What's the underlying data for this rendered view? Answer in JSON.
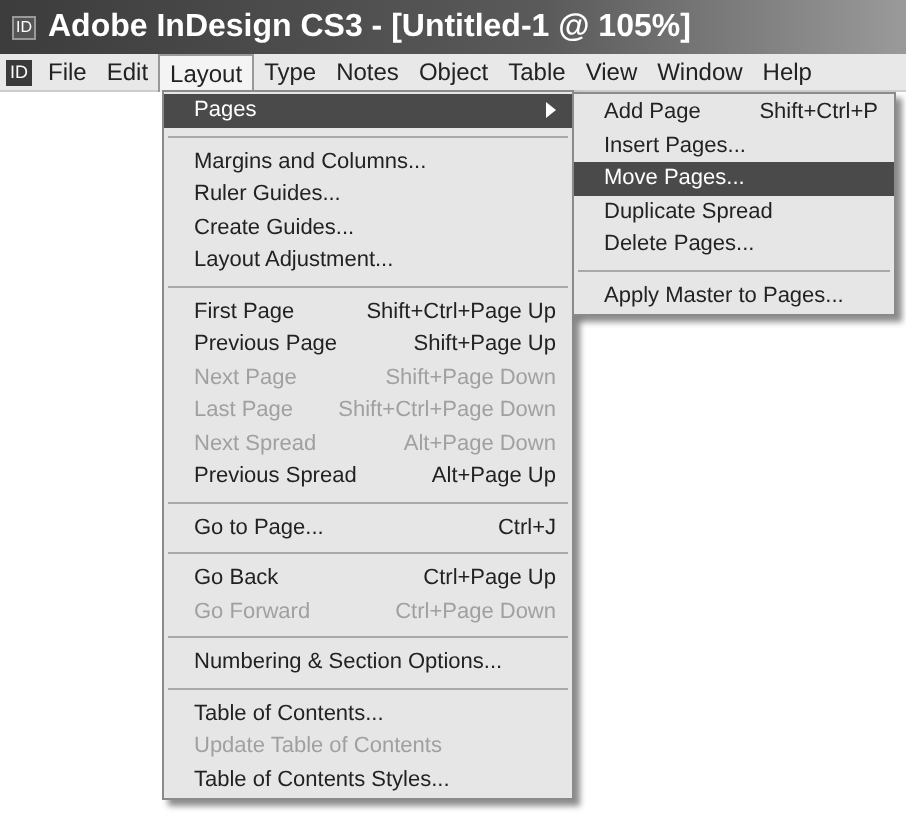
{
  "window": {
    "title": "Adobe InDesign CS3 - [Untitled-1 @ 105%]",
    "app_icon": "ID"
  },
  "menubar_icon": "ID",
  "menubar": [
    {
      "label": "File",
      "selected": false
    },
    {
      "label": "Edit",
      "selected": false
    },
    {
      "label": "Layout",
      "selected": true
    },
    {
      "label": "Type",
      "selected": false
    },
    {
      "label": "Notes",
      "selected": false
    },
    {
      "label": "Object",
      "selected": false
    },
    {
      "label": "Table",
      "selected": false
    },
    {
      "label": "View",
      "selected": false
    },
    {
      "label": "Window",
      "selected": false
    },
    {
      "label": "Help",
      "selected": false
    }
  ],
  "layout_menu": {
    "sections": [
      [
        {
          "label": "Pages",
          "selected": true,
          "disabled": false,
          "submenu": true
        }
      ],
      [
        {
          "label": "Margins and Columns...",
          "selected": false,
          "disabled": false
        },
        {
          "label": "Ruler Guides...",
          "selected": false,
          "disabled": false
        },
        {
          "label": "Create Guides...",
          "selected": false,
          "disabled": false
        },
        {
          "label": "Layout Adjustment...",
          "selected": false,
          "disabled": false
        }
      ],
      [
        {
          "label": "First Page",
          "shortcut": "Shift+Ctrl+Page Up",
          "selected": false,
          "disabled": false
        },
        {
          "label": "Previous Page",
          "shortcut": "Shift+Page Up",
          "selected": false,
          "disabled": false
        },
        {
          "label": "Next Page",
          "shortcut": "Shift+Page Down",
          "selected": false,
          "disabled": true
        },
        {
          "label": "Last Page",
          "shortcut": "Shift+Ctrl+Page Down",
          "selected": false,
          "disabled": true
        },
        {
          "label": "Next Spread",
          "shortcut": "Alt+Page Down",
          "selected": false,
          "disabled": true
        },
        {
          "label": "Previous Spread",
          "shortcut": "Alt+Page Up",
          "selected": false,
          "disabled": false
        }
      ],
      [
        {
          "label": "Go to Page...",
          "shortcut": "Ctrl+J",
          "selected": false,
          "disabled": false
        }
      ],
      [
        {
          "label": "Go Back",
          "shortcut": "Ctrl+Page Up",
          "selected": false,
          "disabled": false
        },
        {
          "label": "Go Forward",
          "shortcut": "Ctrl+Page Down",
          "selected": false,
          "disabled": true
        }
      ],
      [
        {
          "label": "Numbering & Section Options...",
          "selected": false,
          "disabled": false
        }
      ],
      [
        {
          "label": "Table of Contents...",
          "selected": false,
          "disabled": false
        },
        {
          "label": "Update Table of Contents",
          "selected": false,
          "disabled": true
        },
        {
          "label": "Table of Contents Styles...",
          "selected": false,
          "disabled": false
        }
      ]
    ]
  },
  "pages_submenu": {
    "sections": [
      [
        {
          "label": "Add Page",
          "shortcut": "Shift+Ctrl+P",
          "selected": false,
          "disabled": false
        },
        {
          "label": "Insert Pages...",
          "selected": false,
          "disabled": false
        },
        {
          "label": "Move Pages...",
          "selected": true,
          "disabled": false
        },
        {
          "label": "Duplicate Spread",
          "selected": false,
          "disabled": false
        },
        {
          "label": "Delete Pages...",
          "selected": false,
          "disabled": false
        }
      ],
      [
        {
          "label": "Apply Master to Pages...",
          "selected": false,
          "disabled": false
        }
      ]
    ]
  }
}
